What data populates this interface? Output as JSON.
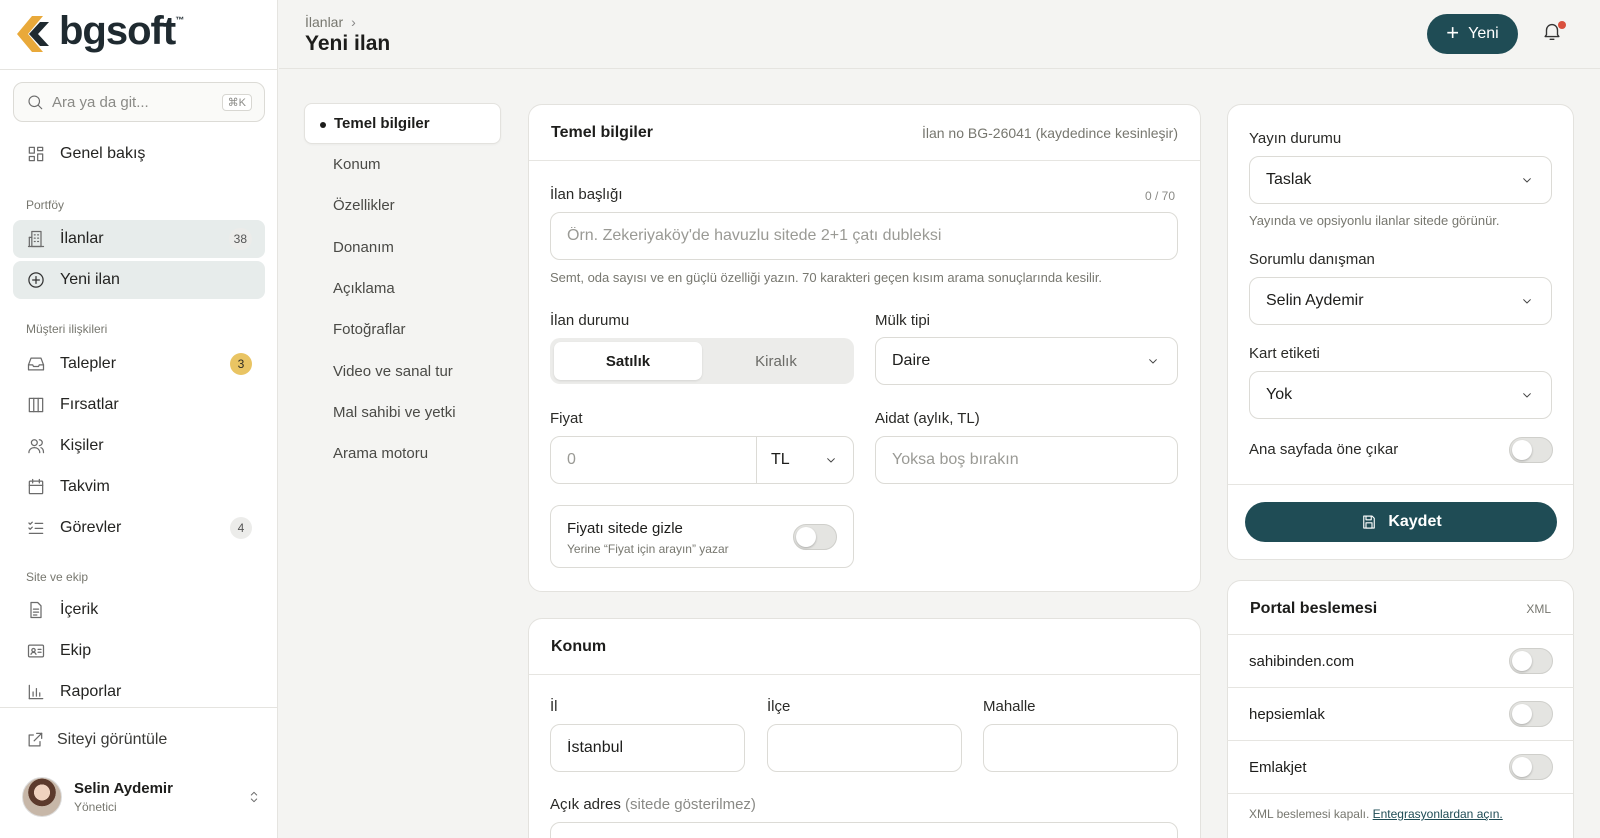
{
  "brand": {
    "name": "bgsoft",
    "tm": "™",
    "logo_colors": [
      "#e9a93a",
      "#1f2a30"
    ]
  },
  "search": {
    "placeholder": "Ara ya da git...",
    "shortcut": "⌘K"
  },
  "sidebar": {
    "overview": {
      "label": "Genel bakış",
      "icon": "grid-icon"
    },
    "sections": {
      "portfolio": "Portföy",
      "customers": "Müşteri ilişkileri",
      "site_team": "Site ve ekip"
    },
    "portfolio_items": [
      {
        "label": "İlanlar",
        "badge": "38",
        "icon": "building-icon"
      },
      {
        "label": "Yeni ilan",
        "icon": "plus-circle-icon",
        "active": true
      }
    ],
    "customer_items": [
      {
        "label": "Talepler",
        "badge": "3",
        "icon": "inbox-icon"
      },
      {
        "label": "Fırsatlar",
        "icon": "columns-icon"
      },
      {
        "label": "Kişiler",
        "icon": "users-icon"
      },
      {
        "label": "Takvim",
        "icon": "calendar-icon"
      },
      {
        "label": "Görevler",
        "badge": "4",
        "icon": "checklist-icon"
      }
    ],
    "site_items": [
      {
        "label": "İçerik",
        "icon": "document-icon"
      },
      {
        "label": "Ekip",
        "icon": "id-card-icon"
      },
      {
        "label": "Raporlar",
        "icon": "bar-chart-icon"
      }
    ],
    "view_site": "Siteyi görüntüle",
    "user": {
      "name": "Selin Aydemir",
      "role": "Yönetici"
    }
  },
  "header": {
    "breadcrumb": "İlanlar",
    "title": "Yeni ilan",
    "new_button": "Yeni"
  },
  "section_nav": [
    "Temel bilgiler",
    "Konum",
    "Özellikler",
    "Donanım",
    "Açıklama",
    "Fotoğraflar",
    "Video ve sanal tur",
    "Mal sahibi ve yetki",
    "Arama motoru"
  ],
  "basic": {
    "title": "Temel bilgiler",
    "note": "İlan no BG-26041 (kaydedince kesinleşir)",
    "listing_title_label": "İlan başlığı",
    "counter": "0 / 70",
    "listing_title_placeholder": "Örn. Zekeriyaköy'de havuzlu sitede 2+1 çatı dubleksi",
    "listing_title_hint": "Semt, oda sayısı ve en güçlü özelliği yazın. 70 karakteri geçen kısım arama sonuçlarında kesilir.",
    "status_label": "İlan durumu",
    "status_options": [
      "Satılık",
      "Kiralık"
    ],
    "status_selected": "Satılık",
    "property_type_label": "Mülk tipi",
    "property_type_value": "Daire",
    "price_label": "Fiyat",
    "price_placeholder": "0",
    "currency": "TL",
    "dues_label": "Aidat (aylık, TL)",
    "dues_placeholder": "Yoksa boş bırakın",
    "hide_price_title": "Fiyatı sitede gizle",
    "hide_price_sub": "Yerine “Fiyat için arayın” yazar",
    "hide_price_on": false
  },
  "location": {
    "title": "Konum",
    "province_label": "İl",
    "province_value": "İstanbul",
    "district_label": "İlçe",
    "district_value": "",
    "neighborhood_label": "Mahalle",
    "neighborhood_value": "",
    "address_label": "Açık adres",
    "address_note": "(sitede gösterilmez)"
  },
  "publish": {
    "status_label": "Yayın durumu",
    "status_value": "Taslak",
    "status_hint": "Yayında ve opsiyonlu ilanlar sitede görünür.",
    "agent_label": "Sorumlu danışman",
    "agent_value": "Selin Aydemir",
    "card_tag_label": "Kart etiketi",
    "card_tag_value": "Yok",
    "featured_label": "Ana sayfada öne çıkar",
    "featured_on": false,
    "save_button": "Kaydet"
  },
  "portal": {
    "title": "Portal beslemesi",
    "format": "XML",
    "portals": [
      {
        "name": "sahibinden.com",
        "on": false
      },
      {
        "name": "hepsiemlak",
        "on": false
      },
      {
        "name": "Emlakjet",
        "on": false
      }
    ],
    "footer_text": "XML beslemesi kapalı.",
    "footer_link": "Entegrasyonlardan açın."
  },
  "colors": {
    "primary": "#1f4c55",
    "accent": "#e9a93a",
    "badge_yellow": "#e9c463",
    "notification": "#d9503e"
  }
}
